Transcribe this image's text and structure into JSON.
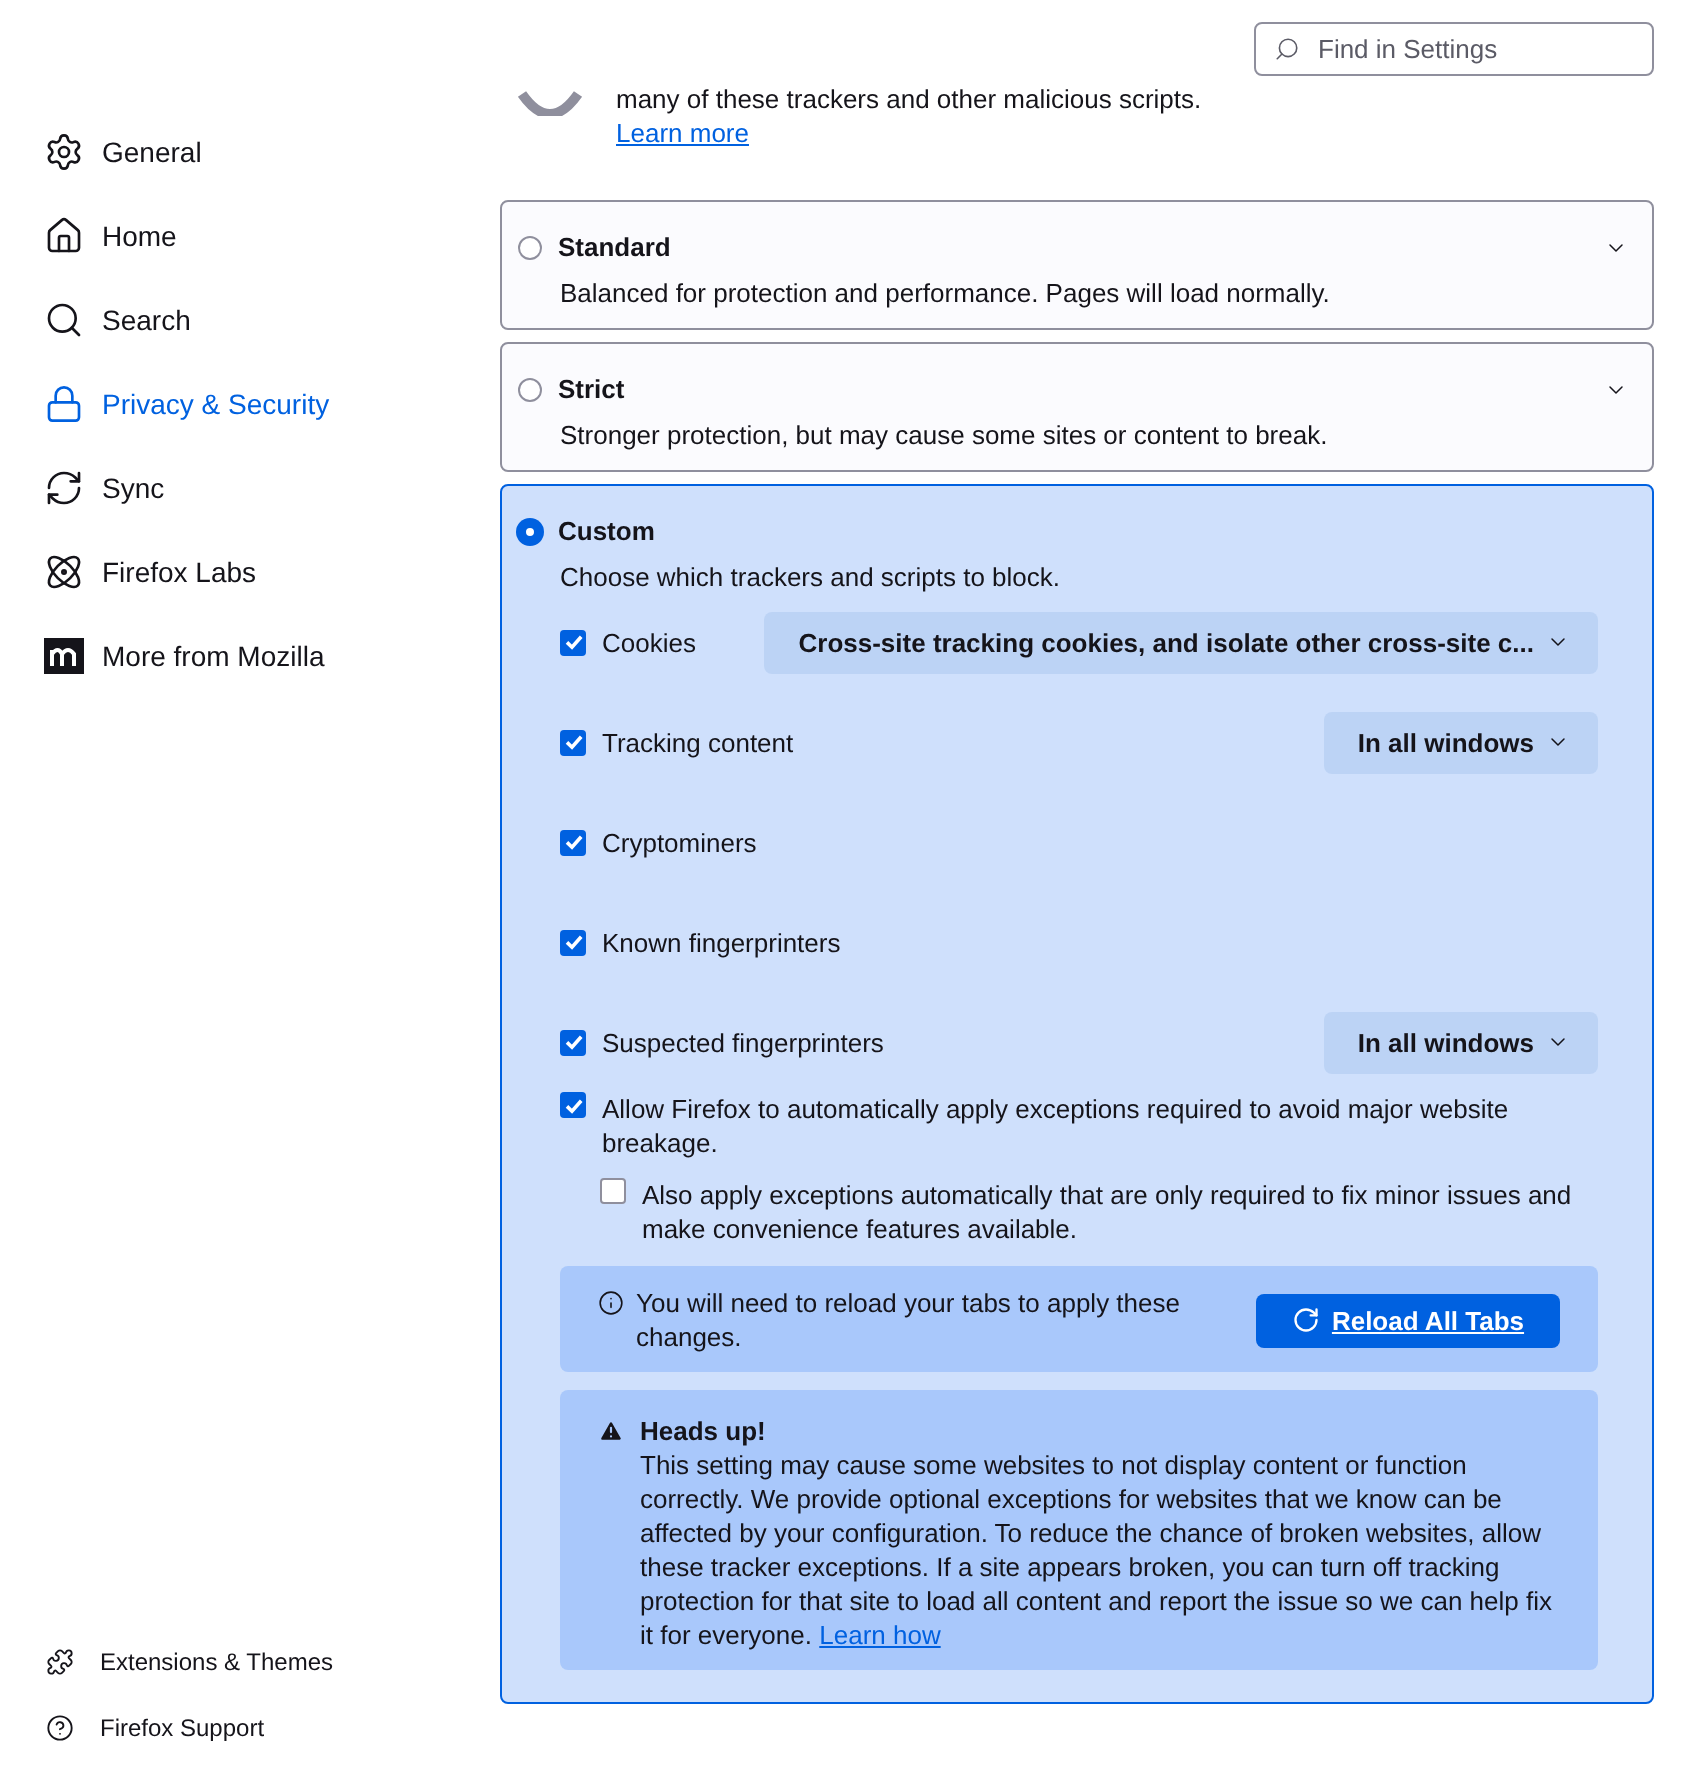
{
  "search": {
    "placeholder": "Find in Settings"
  },
  "sidebar": {
    "items": [
      {
        "label": "General",
        "selected": false
      },
      {
        "label": "Home",
        "selected": false
      },
      {
        "label": "Search",
        "selected": false
      },
      {
        "label": "Privacy & Security",
        "selected": true
      },
      {
        "label": "Sync",
        "selected": false
      },
      {
        "label": "Firefox Labs",
        "selected": false
      },
      {
        "label": "More from Mozilla",
        "selected": false
      }
    ],
    "footer_items": [
      {
        "label": "Extensions & Themes"
      },
      {
        "label": "Firefox Support"
      }
    ]
  },
  "intro": {
    "text": "many of these trackers and other malicious scripts.",
    "link": "Learn more"
  },
  "levels": [
    {
      "title": "Standard",
      "description": "Balanced for protection and performance. Pages will load normally.",
      "selected": false
    },
    {
      "title": "Strict",
      "description": "Stronger protection, but may cause some sites or content to break.",
      "selected": false
    },
    {
      "title": "Custom",
      "description": "Choose which trackers and scripts to block.",
      "selected": true
    }
  ],
  "custom": {
    "options": [
      {
        "label": "Cookies",
        "checked": true,
        "dropdown": "Cross-site tracking cookies, and isolate other cross-site c..."
      },
      {
        "label": "Tracking content",
        "checked": true,
        "dropdown": "In all windows"
      },
      {
        "label": "Cryptominers",
        "checked": true
      },
      {
        "label": "Known fingerprinters",
        "checked": true
      },
      {
        "label": "Suspected fingerprinters",
        "checked": true,
        "dropdown": "In all windows"
      }
    ],
    "exceptions": [
      {
        "label": "Allow Firefox to automatically apply exceptions required to avoid major website breakage.",
        "checked": true
      },
      {
        "label": "Also apply exceptions automatically that are only required to fix minor issues and make convenience features available.",
        "checked": false
      }
    ],
    "reload_notice": {
      "text": "You will need to reload your tabs to apply these changes.",
      "button": "Reload All Tabs"
    },
    "warning": {
      "title": "Heads up!",
      "text": "This setting may cause some websites to not display content or function correctly. We provide optional exceptions for websites that we know can be affected by your configuration. To reduce the chance of broken websites, allow these tracker exceptions. If a site appears broken, you can turn off tracking protection for that site to load all content and report the issue so we can help fix it for everyone.",
      "link": "Learn how"
    }
  }
}
